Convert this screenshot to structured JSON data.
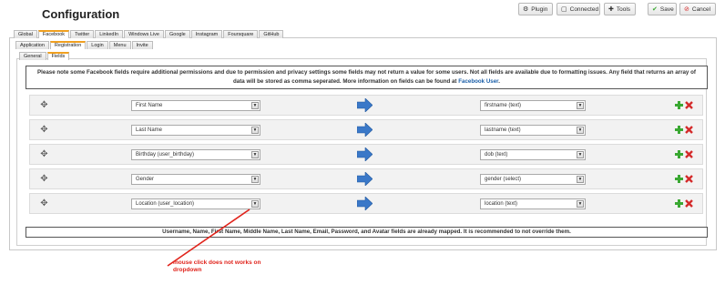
{
  "page": {
    "title": "Configuration"
  },
  "toolbar": {
    "plugin": "Plugin",
    "connected": "Connected",
    "tools": "Tools",
    "save": "Save",
    "cancel": "Cancel"
  },
  "tabs_level1": [
    "Global",
    "Facebook",
    "Twitter",
    "LinkedIn",
    "Windows Live",
    "Google",
    "Instagram",
    "Foursquare",
    "GitHub"
  ],
  "tabs_level1_active": "Facebook",
  "tabs_level2": [
    "Application",
    "Registration",
    "Login",
    "Menu",
    "Invite"
  ],
  "tabs_level2_active": "Registration",
  "tabs_level3": [
    "General",
    "Fields"
  ],
  "tabs_level3_active": "Fields",
  "notice": {
    "text": "Please note some Facebook fields require additional permissions and due to permission and privacy settings some fields may not return a value for some users. Not all fields are available due to formatting issues. Any field that returns an array of data will be stored as comma seperated. More information on fields can be found at ",
    "link": "Facebook User",
    "end": "."
  },
  "mappings": [
    {
      "source": "First Name",
      "target": "firstname (text)"
    },
    {
      "source": "Last Name",
      "target": "lastname (text)"
    },
    {
      "source": "Birthday (user_birthday)",
      "target": "dob (text)"
    },
    {
      "source": "Gender",
      "target": "gender (select)"
    },
    {
      "source": "Location (user_location)",
      "target": "location (text)"
    }
  ],
  "footer_note": "Username, Name, First Name, Middle Name, Last Name, Email, Password, and Avatar fields are already mapped. It is recommended to not override them.",
  "annotation": "mouse click does not works on dropdown",
  "colors": {
    "accent_tab": "#f0a020",
    "annotation": "#e0231b",
    "arrow": "#3a78c8",
    "add": "#3aa832",
    "remove": "#d42a2a"
  },
  "icons": {
    "drag": "drag-handle-icon",
    "arrow": "right-arrow-icon",
    "add": "add-icon",
    "remove": "remove-icon"
  }
}
